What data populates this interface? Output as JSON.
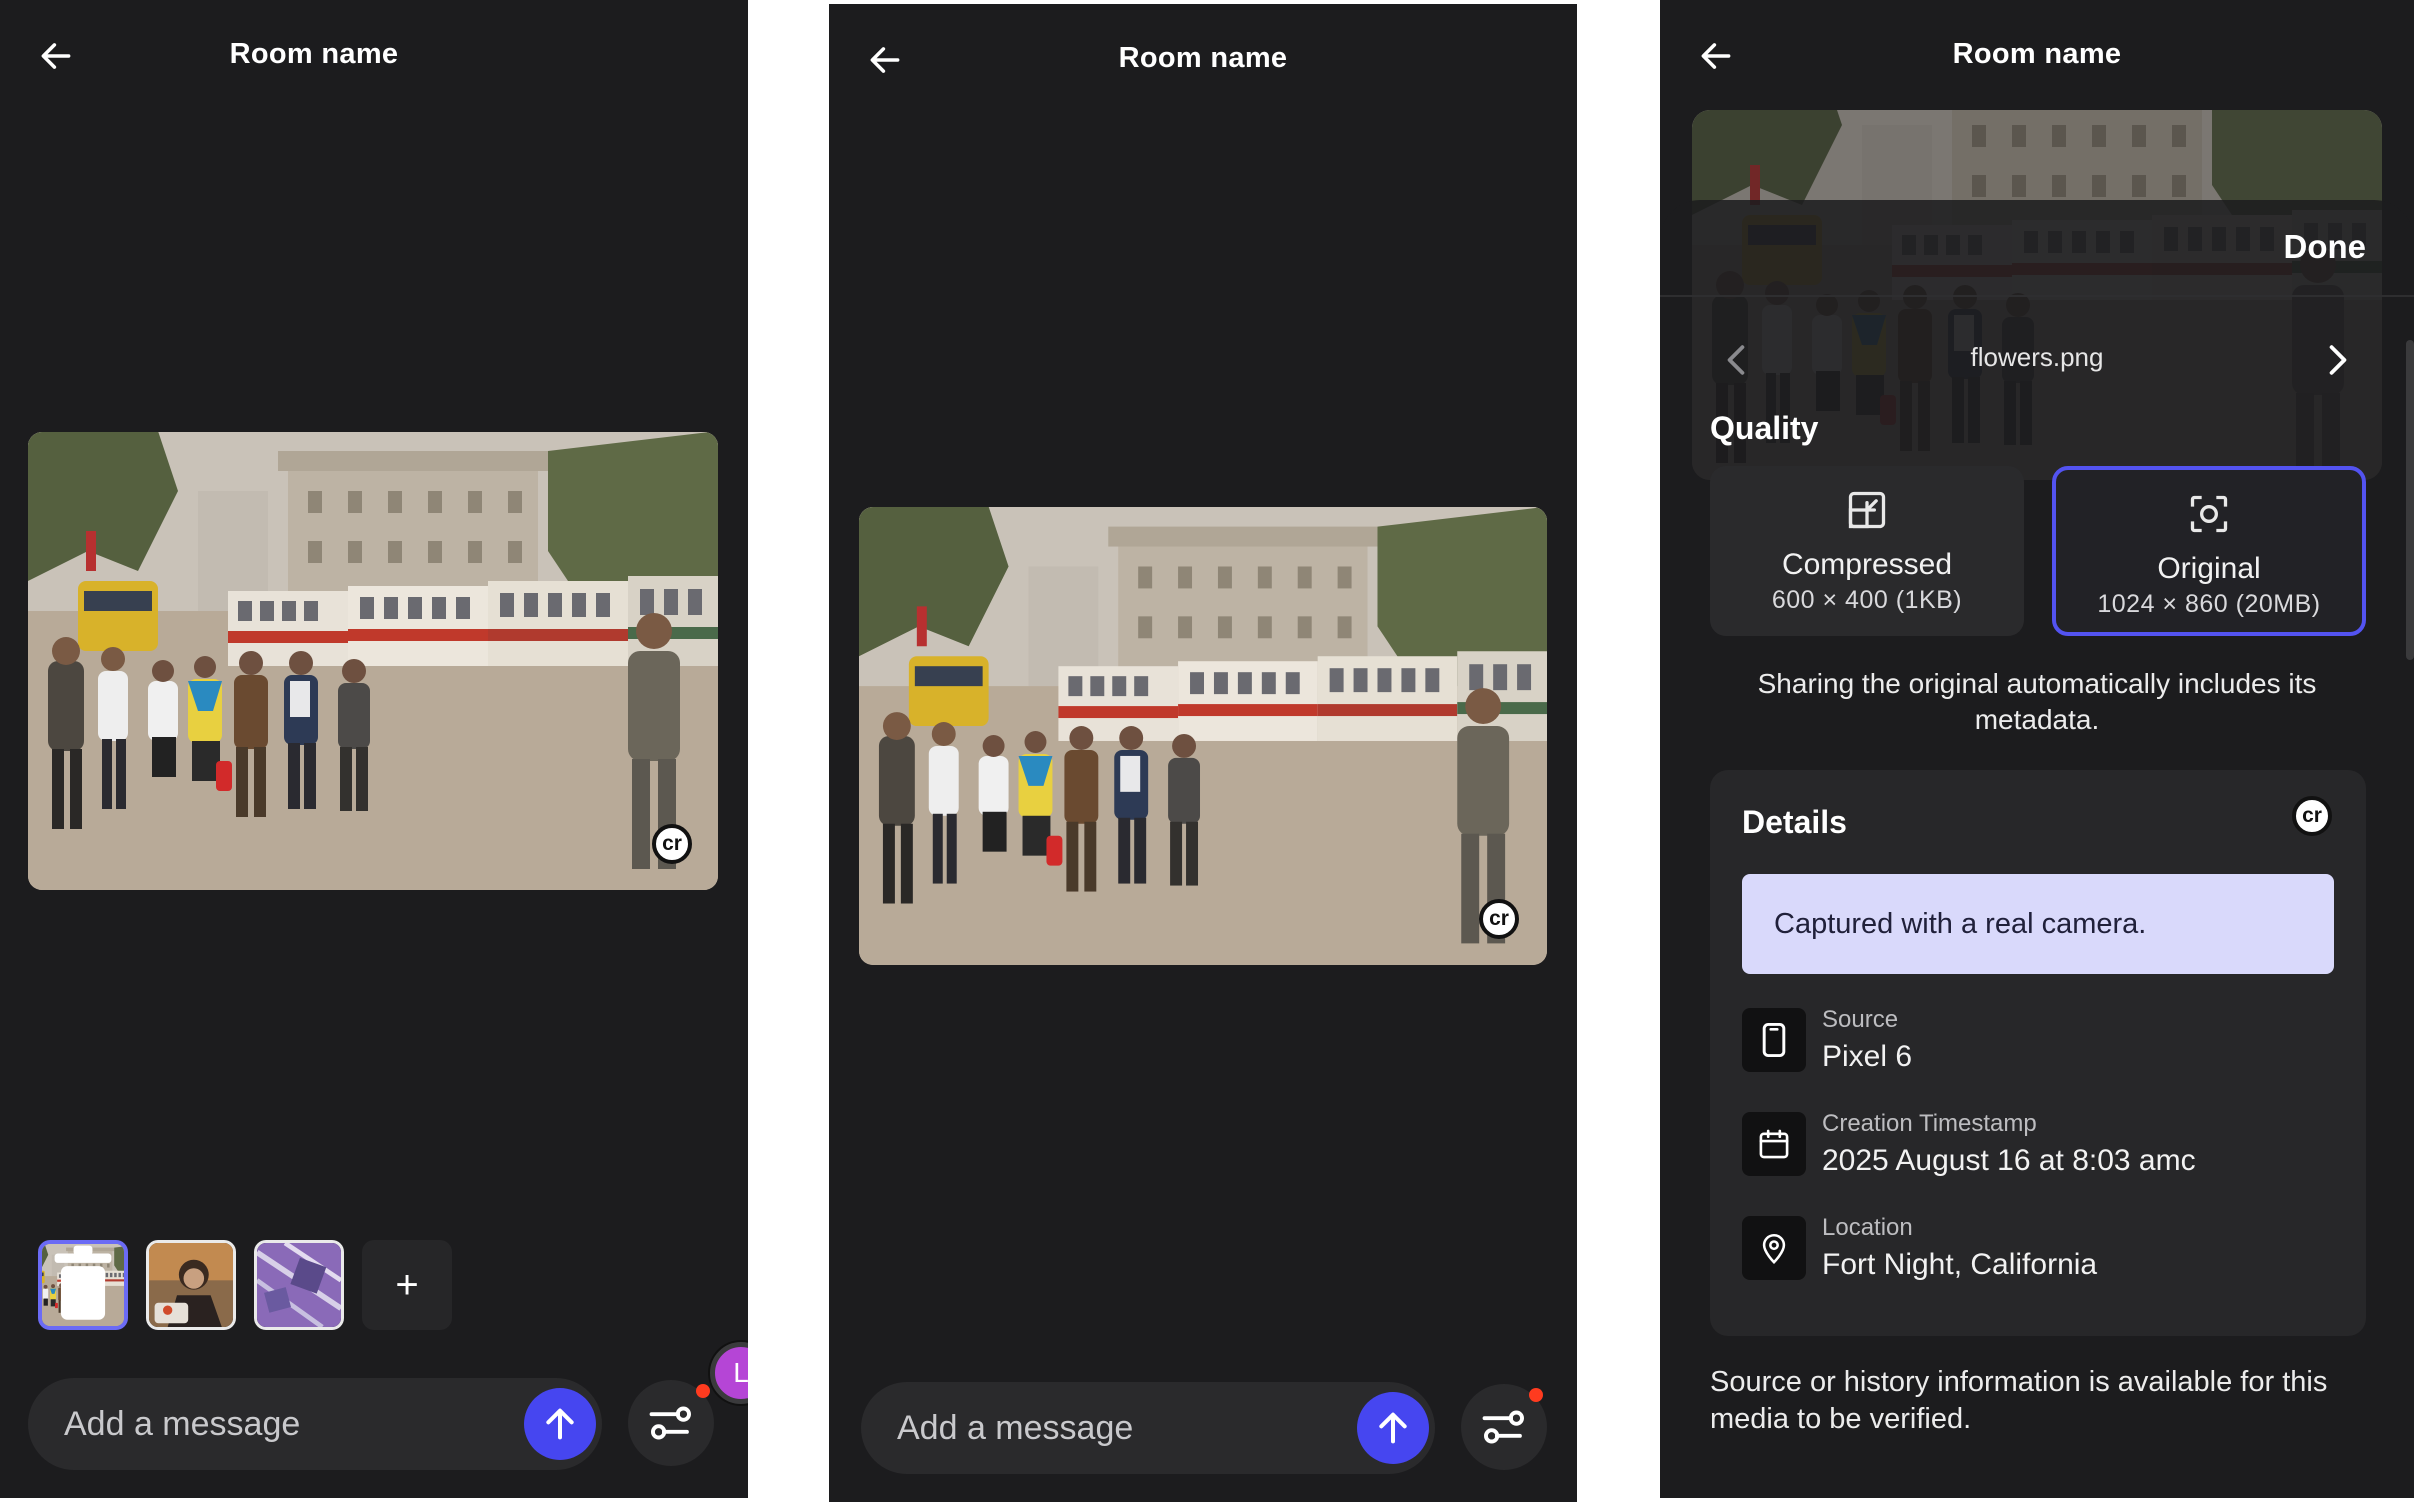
{
  "header": {
    "room_name": "Room name"
  },
  "composer": {
    "placeholder": "Add a message"
  },
  "screen1": {
    "thumbnails": [
      "photo-street",
      "photo-person",
      "photo-purple"
    ],
    "add_label": "+",
    "avatar_initial": "L"
  },
  "sheet": {
    "done_label": "Done",
    "file_name": "flowers.png",
    "quality_title": "Quality",
    "options": [
      {
        "label": "Compressed",
        "size": "600 × 400 (1KB)",
        "selected": false
      },
      {
        "label": "Original",
        "size": "1024 × 860 (20MB)",
        "selected": true
      }
    ],
    "sharing_note": "Sharing the original automatically includes its metadata.",
    "details": {
      "title": "Details",
      "banner": "Captured with a real camera.",
      "items": [
        {
          "label": "Source",
          "value": "Pixel 6",
          "icon": "phone-icon"
        },
        {
          "label": "Creation Timestamp",
          "value": "2025 August 16 at 8:03 amc",
          "icon": "calendar-icon"
        },
        {
          "label": "Location",
          "value": "Fort Night, California",
          "icon": "location-pin-icon"
        }
      ]
    },
    "footer_note": "Source or history information is available for this media to be verified."
  },
  "colors": {
    "background": "#1c1c1e",
    "accent": "#4646f0",
    "selected_border": "#5353f1",
    "banner": "#d9d9fb",
    "notification_dot": "#ff3b1f",
    "avatar": "#b545d6"
  },
  "badge_text": "cr"
}
